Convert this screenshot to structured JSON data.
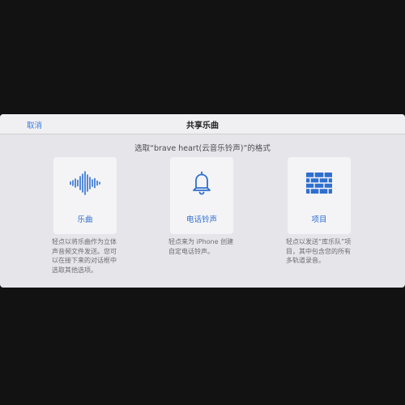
{
  "navbar": {
    "cancel_label": "取消",
    "title": "共享乐曲"
  },
  "subtitle": "选取“brave heart(云音乐铃声)”的格式",
  "options": [
    {
      "label": "乐曲",
      "icon": "waveform-icon",
      "description": "轻点以将乐曲作为立体声音频文件发送。您可以在接下来的对话框中选取其他选项。"
    },
    {
      "label": "电话铃声",
      "icon": "bell-icon",
      "description": "轻点来为 iPhone 创建自定电话铃声。"
    },
    {
      "label": "项目",
      "icon": "bricks-icon",
      "description": "轻点以发送“库乐队”项目，其中包含您的所有多轨道录音。"
    }
  ],
  "colors": {
    "accent": "#2f6fd0",
    "background": "#121212",
    "dialog": "#e6e6ea",
    "card": "#f4f4f6"
  }
}
